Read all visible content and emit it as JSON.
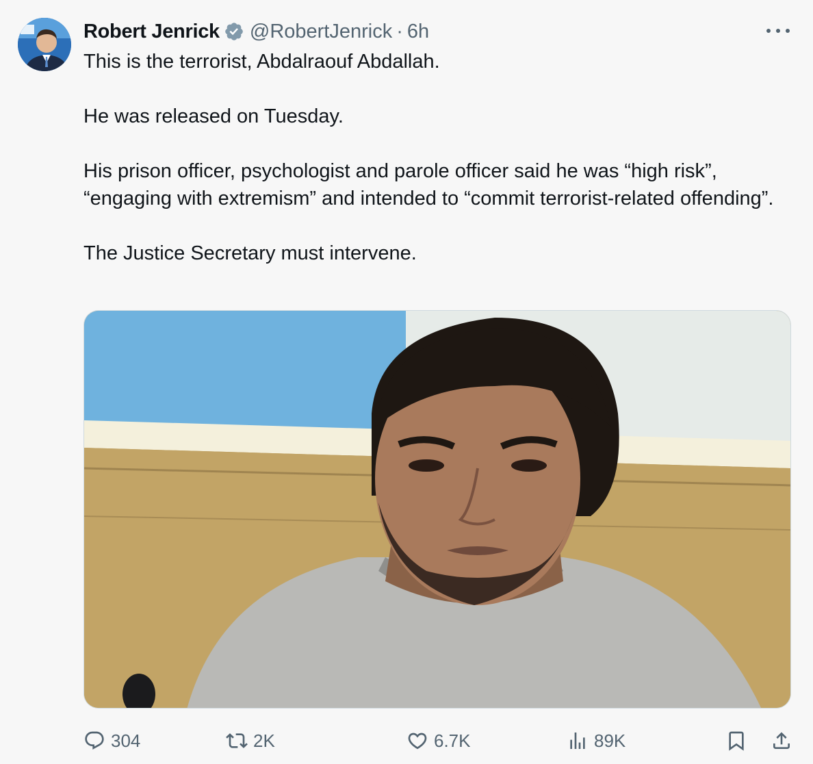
{
  "tweet": {
    "author_name": "Robert Jenrick",
    "author_handle": "@RobertJenrick",
    "separator": "·",
    "time": "6h",
    "paragraphs": [
      "This is the terrorist, Abdalraouf Abdallah.",
      "He was released on Tuesday.",
      "His prison officer, psychologist and parole officer said he was “high risk”, “engaging with extremism” and intended to “commit terrorist-related offending”.",
      "The Justice Secretary must intervene."
    ]
  },
  "icons": {
    "verified": "verified-badge-icon",
    "more": "more-options-icon",
    "reply": "reply-icon",
    "repost": "repost-icon",
    "like": "like-icon",
    "views": "views-icon",
    "bookmark": "bookmark-icon",
    "share": "share-icon"
  },
  "actions": {
    "replies": "304",
    "reposts": "2K",
    "likes": "6.7K",
    "views": "89K"
  },
  "colors": {
    "text": "#0f1419",
    "muted": "#536471",
    "verified": "#829aab",
    "background": "#f7f7f7"
  }
}
